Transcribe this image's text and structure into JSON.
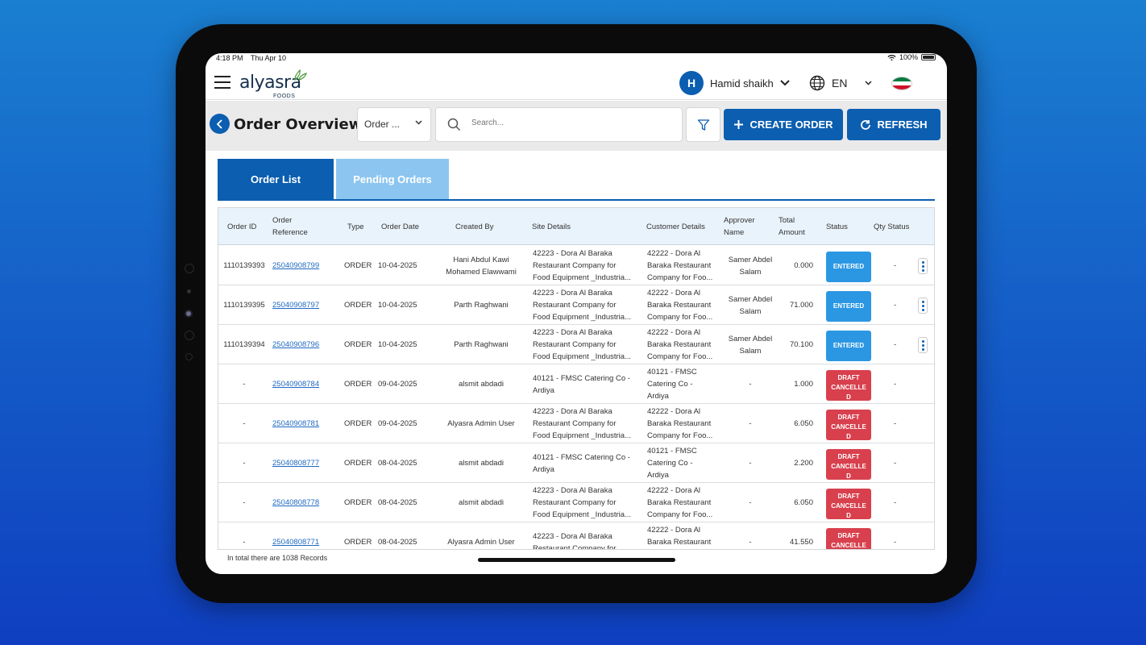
{
  "status_bar": {
    "time": "4:18 PM",
    "day": "Thu Apr 10",
    "battery": "100%"
  },
  "header": {
    "logo_text": "alyasra",
    "logo_sub": "FOODS",
    "user_initial": "H",
    "user_name": "Hamid shaikh",
    "language": "EN"
  },
  "toolbar": {
    "title": "Order Overview",
    "filter_select_value": "Order ...",
    "search_placeholder": "Search...",
    "create_label": "CREATE ORDER",
    "refresh_label": "REFRESH"
  },
  "tabs": [
    {
      "label": "Order List",
      "active": true
    },
    {
      "label": "Pending Orders",
      "active": false
    }
  ],
  "table": {
    "headers": {
      "order_id": "Order ID",
      "order_ref_1": "Order",
      "order_ref_2": "Reference",
      "type": "Type",
      "order_date": "Order Date",
      "created_by": "Created By",
      "site": "Site Details",
      "customer": "Customer Details",
      "approver_1": "Approver",
      "approver_2": "Name",
      "amount_1": "Total",
      "amount_2": "Amount",
      "status": "Status",
      "qty": "Qty Status"
    },
    "rows": [
      {
        "id": "1110139393",
        "ref": "25040908799",
        "type": "ORDER",
        "date": "10-04-2025",
        "created_1": "Hani Abdul Kawi",
        "created_2": "Mohamed Elawwami",
        "site_1": "42223 - Dora Al Baraka",
        "site_2": "Restaurant Company for",
        "site_3": "Food Equipment _Industria...",
        "cust_1": "42222 - Dora Al",
        "cust_2": "Baraka Restaurant",
        "cust_3": "Company for Foo...",
        "approver_1": "Samer Abdel",
        "approver_2": "Salam",
        "amount": "0.000",
        "status_1": "ENTERED",
        "status_2": "",
        "status_3": "",
        "qty": "-"
      },
      {
        "id": "1110139395",
        "ref": "25040908797",
        "type": "ORDER",
        "date": "10-04-2025",
        "created_1": "Parth Raghwani",
        "created_2": "",
        "site_1": "42223 - Dora Al Baraka",
        "site_2": "Restaurant Company for",
        "site_3": "Food Equipment _Industria...",
        "cust_1": "42222 - Dora Al",
        "cust_2": "Baraka Restaurant",
        "cust_3": "Company for Foo...",
        "approver_1": "Samer Abdel",
        "approver_2": "Salam",
        "amount": "71.000",
        "status_1": "ENTERED",
        "status_2": "",
        "status_3": "",
        "qty": "-"
      },
      {
        "id": "1110139394",
        "ref": "25040908796",
        "type": "ORDER",
        "date": "10-04-2025",
        "created_1": "Parth Raghwani",
        "created_2": "",
        "site_1": "42223 - Dora Al Baraka",
        "site_2": "Restaurant Company for",
        "site_3": "Food Equipment _Industria...",
        "cust_1": "42222 - Dora Al",
        "cust_2": "Baraka Restaurant",
        "cust_3": "Company for Foo...",
        "approver_1": "Samer Abdel",
        "approver_2": "Salam",
        "amount": "70.100",
        "status_1": "ENTERED",
        "status_2": "",
        "status_3": "",
        "qty": "-"
      },
      {
        "id": "-",
        "ref": "25040908784",
        "type": "ORDER",
        "date": "09-04-2025",
        "created_1": "alsmit abdadi",
        "created_2": "",
        "site_1": "40121 - FMSC Catering Co -",
        "site_2": "Ardiya",
        "site_3": "",
        "cust_1": "40121 - FMSC",
        "cust_2": "Catering Co -",
        "cust_3": "Ardiya",
        "approver_1": "-",
        "approver_2": "",
        "amount": "1.000",
        "status_1": "DRAFT",
        "status_2": "CANCELLE",
        "status_3": "D",
        "qty": "-"
      },
      {
        "id": "-",
        "ref": "25040908781",
        "type": "ORDER",
        "date": "09-04-2025",
        "created_1": "Alyasra Admin User",
        "created_2": "",
        "site_1": "42223 - Dora Al Baraka",
        "site_2": "Restaurant Company for",
        "site_3": "Food Equipment _Industria...",
        "cust_1": "42222 - Dora Al",
        "cust_2": "Baraka Restaurant",
        "cust_3": "Company for Foo...",
        "approver_1": "-",
        "approver_2": "",
        "amount": "6.050",
        "status_1": "DRAFT",
        "status_2": "CANCELLE",
        "status_3": "D",
        "qty": "-"
      },
      {
        "id": "-",
        "ref": "25040808777",
        "type": "ORDER",
        "date": "08-04-2025",
        "created_1": "alsmit abdadi",
        "created_2": "",
        "site_1": "40121 - FMSC Catering Co -",
        "site_2": "Ardiya",
        "site_3": "",
        "cust_1": "40121 - FMSC",
        "cust_2": "Catering Co -",
        "cust_3": "Ardiya",
        "approver_1": "-",
        "approver_2": "",
        "amount": "2.200",
        "status_1": "DRAFT",
        "status_2": "CANCELLE",
        "status_3": "D",
        "qty": "-"
      },
      {
        "id": "-",
        "ref": "25040808778",
        "type": "ORDER",
        "date": "08-04-2025",
        "created_1": "alsmit abdadi",
        "created_2": "",
        "site_1": "42223 - Dora Al Baraka",
        "site_2": "Restaurant Company for",
        "site_3": "Food Equipment _Industria...",
        "cust_1": "42222 - Dora Al",
        "cust_2": "Baraka Restaurant",
        "cust_3": "Company for Foo...",
        "approver_1": "-",
        "approver_2": "",
        "amount": "6.050",
        "status_1": "DRAFT",
        "status_2": "CANCELLE",
        "status_3": "D",
        "qty": "-"
      },
      {
        "id": "-",
        "ref": "25040808771",
        "type": "ORDER",
        "date": "08-04-2025",
        "created_1": "Alyasra Admin User",
        "created_2": "",
        "site_1": "42223 - Dora Al Baraka",
        "site_2": "Restaurant Company for",
        "site_3": "",
        "cust_1": "42222 - Dora Al",
        "cust_2": "Baraka Restaurant",
        "cust_3": "",
        "approver_1": "-",
        "approver_2": "",
        "amount": "41.550",
        "status_1": "DRAFT",
        "status_2": "CANCELLE",
        "status_3": "",
        "qty": "-"
      }
    ]
  },
  "footer_note": "In total there are 1038 Records",
  "colors": {
    "primary": "#0b5eb0",
    "entered": "#2b97e3",
    "draft_cancelled": "#d8404d",
    "tab_inactive": "#8cc6f0"
  }
}
